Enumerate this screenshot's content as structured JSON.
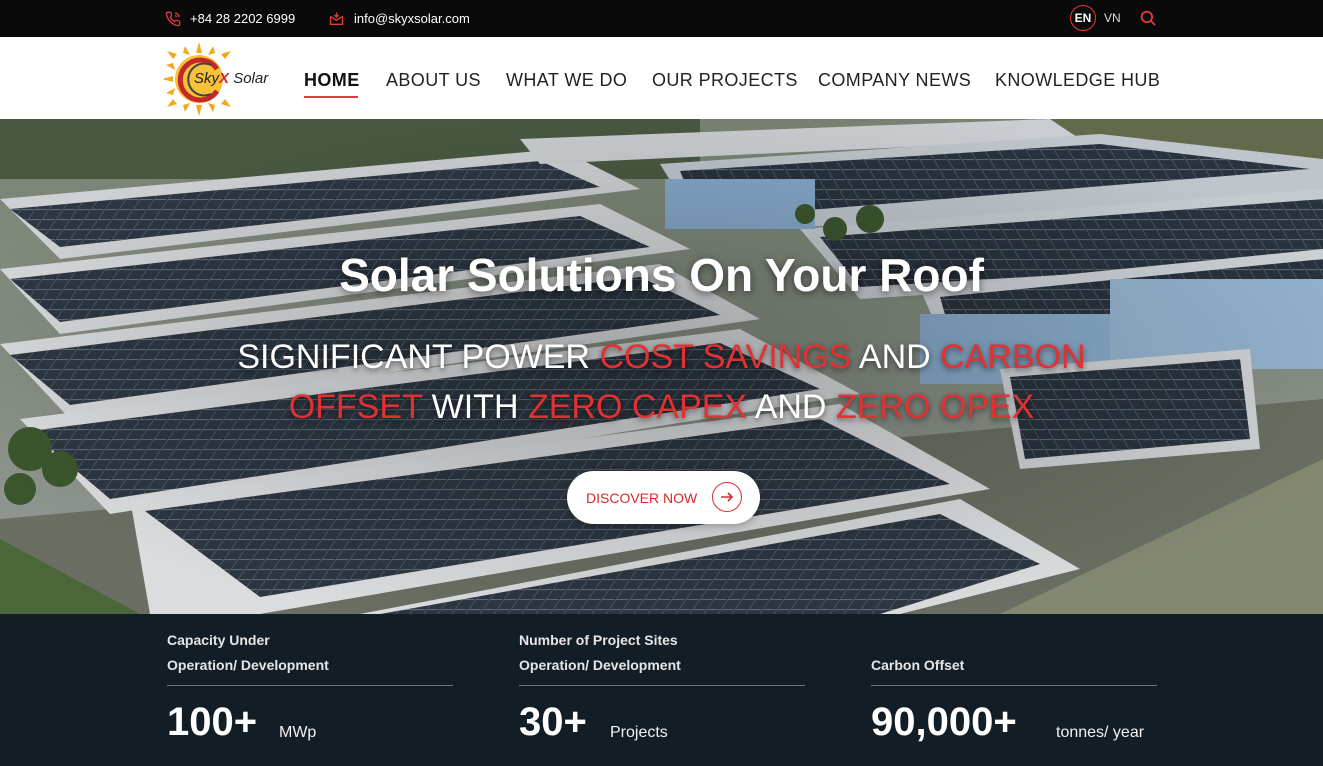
{
  "topbar": {
    "phone": "+84 28 2202 6999",
    "email": "info@skyxsolar.com",
    "lang_en": "EN",
    "lang_vn": "VN",
    "icons": {
      "phone": "phone-icon",
      "email": "email-icon",
      "search": "search-icon"
    },
    "accent_color": "#e23b3b"
  },
  "logo": {
    "part1": "Sky",
    "part2": "X",
    "part3": " Solar"
  },
  "nav": {
    "items": [
      {
        "label": "HOME",
        "active": true
      },
      {
        "label": "ABOUT US"
      },
      {
        "label": "WHAT WE DO"
      },
      {
        "label": "OUR PROJECTS"
      },
      {
        "label": "COMPANY NEWS"
      },
      {
        "label": "KNOWLEDGE HUB"
      }
    ]
  },
  "hero": {
    "title": "Solar Solutions On Your Roof",
    "subtitle": {
      "w1": "SIGNIFICANT POWER ",
      "r1": "COST SAVINGS",
      "w2": " AND ",
      "r2": "CARBON OFFSET",
      "w3": " WITH ",
      "r3": "ZERO CAPEX",
      "w4": " AND ",
      "r4": "ZERO OPEX"
    },
    "cta_label": "DISCOVER NOW",
    "highlight_color": "#e03232"
  },
  "stats": [
    {
      "label_line1": "Capacity Under",
      "label_line2": "Operation/ Development",
      "value": "100+",
      "unit": "MWp"
    },
    {
      "label_line1": "Number of Project Sites",
      "label_line2": "Operation/ Development",
      "value": "30+",
      "unit": "Projects"
    },
    {
      "label_line1": "",
      "label_line2": "Carbon Offset",
      "value": "90,000+",
      "unit": "tonnes/ year"
    }
  ]
}
